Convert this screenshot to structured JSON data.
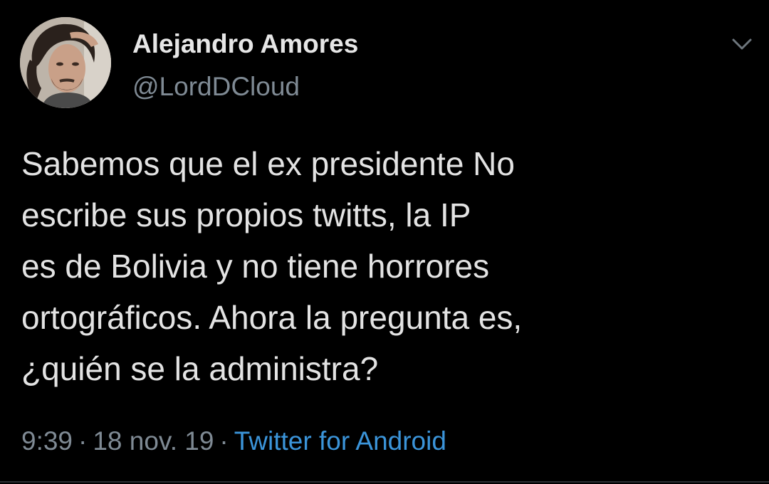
{
  "tweet": {
    "author": {
      "display_name": "Alejandro Amores",
      "handle": "@LordDCloud",
      "avatar_icon": "profile-photo"
    },
    "menu_icon": "chevron-down-icon",
    "text_lines": [
      "Sabemos que el ex presidente No",
      "escribe sus propios twitts, la IP",
      "es de Bolivia y no tiene horrores",
      "ortográficos. Ahora la pregunta es,",
      "¿quién se la administra?"
    ],
    "time": "9:39",
    "separator": "·",
    "date": "18 nov. 19",
    "source": "Twitter for Android"
  },
  "colors": {
    "background": "#000000",
    "text": "#e3e3e3",
    "secondary": "#7f8a94",
    "link": "#3b94d9"
  }
}
